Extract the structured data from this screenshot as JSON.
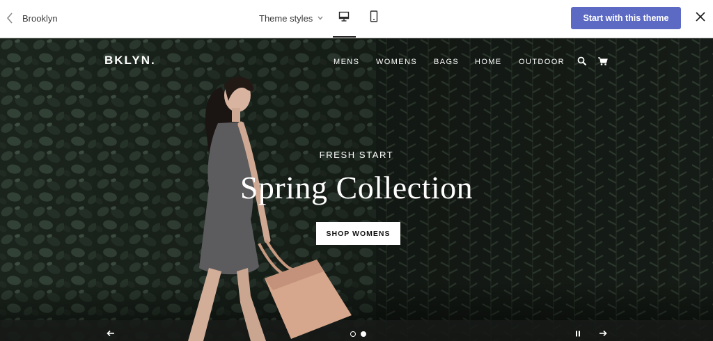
{
  "toolbar": {
    "back_label": "Brooklyn",
    "theme_styles_label": "Theme styles",
    "cta_label": "Start with this theme",
    "accent_color": "#5c6ac4",
    "icons": [
      "chevron-left-icon",
      "chevron-down-icon",
      "desktop-icon",
      "mobile-icon",
      "close-icon"
    ],
    "active_device": "desktop"
  },
  "store": {
    "brand": "BKLYN.",
    "nav": [
      "MENS",
      "WOMENS",
      "BAGS",
      "HOME",
      "OUTDOOR"
    ],
    "nav_icons": [
      "search-icon",
      "cart-icon"
    ],
    "slide": {
      "eyebrow": "FRESH START",
      "title": "Spring Collection",
      "button": "SHOP WOMENS"
    },
    "slider": {
      "controls": [
        "arrow-left-icon",
        "pause-icon",
        "arrow-right-icon"
      ],
      "total_slides": 2,
      "active_slide": 2
    }
  }
}
